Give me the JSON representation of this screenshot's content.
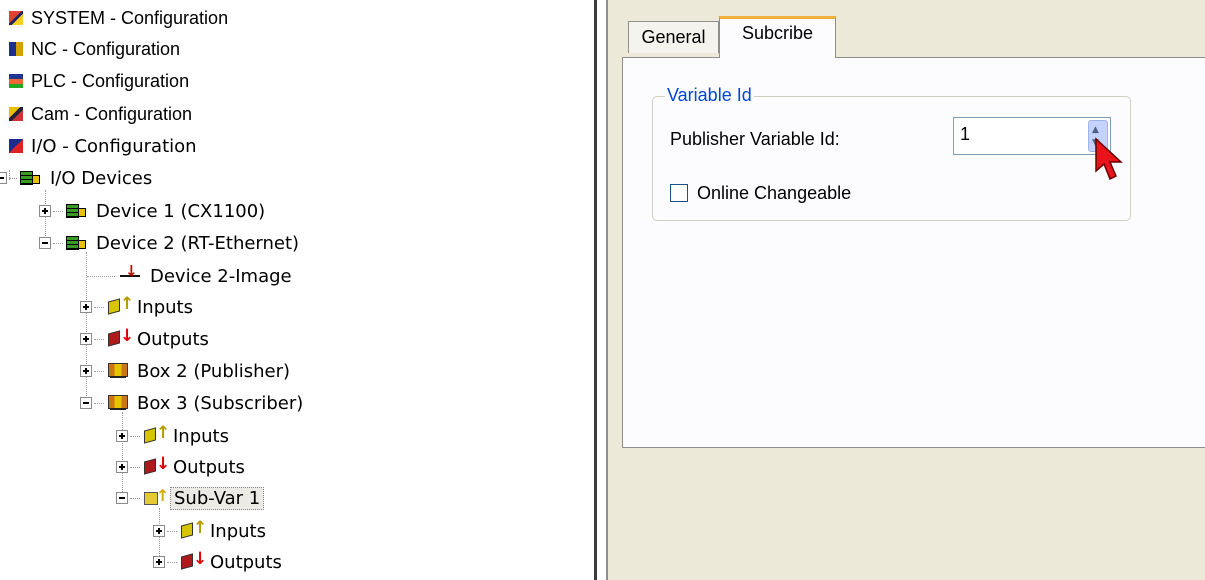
{
  "tree": {
    "items": [
      {
        "label": "SYSTEM - Configuration",
        "icon": "system-config-icon"
      },
      {
        "label": "NC - Configuration",
        "icon": "nc-config-icon"
      },
      {
        "label": "PLC - Configuration",
        "icon": "plc-config-icon"
      },
      {
        "label": "Cam - Configuration",
        "icon": "cam-config-icon"
      },
      {
        "label": "I/O - Configuration",
        "icon": "io-config-icon"
      },
      {
        "label": "I/O Devices",
        "icon": "io-devices-icon"
      },
      {
        "label": "Device 1 (CX1100)",
        "icon": "device-icon"
      },
      {
        "label": "Device 2 (RT-Ethernet)",
        "icon": "device-icon"
      },
      {
        "label": "Device 2-Image",
        "icon": "process-image-icon"
      },
      {
        "label": "Inputs",
        "icon": "inputs-icon"
      },
      {
        "label": "Outputs",
        "icon": "outputs-icon"
      },
      {
        "label": "Box 2 (Publisher)",
        "icon": "box-icon"
      },
      {
        "label": "Box 3 (Subscriber)",
        "icon": "box-icon"
      },
      {
        "label": "Inputs",
        "icon": "inputs-icon"
      },
      {
        "label": "Outputs",
        "icon": "outputs-icon"
      },
      {
        "label": "Sub-Var 1",
        "icon": "sub-var-icon"
      },
      {
        "label": "Inputs",
        "icon": "inputs-icon"
      },
      {
        "label": "Outputs",
        "icon": "outputs-icon"
      }
    ]
  },
  "tabs": [
    {
      "label": "General",
      "active": false
    },
    {
      "label": "Subcribe",
      "active": true
    }
  ],
  "group": {
    "title": "Variable Id",
    "publisher_label": "Publisher Variable Id:",
    "publisher_value": "1",
    "online_changeable_label": "Online Changeable",
    "online_changeable_checked": false
  },
  "colors": {
    "group_title": "#0046d5",
    "active_tab_accent": "#f2b33d",
    "panel_background": "#ece9d8"
  }
}
